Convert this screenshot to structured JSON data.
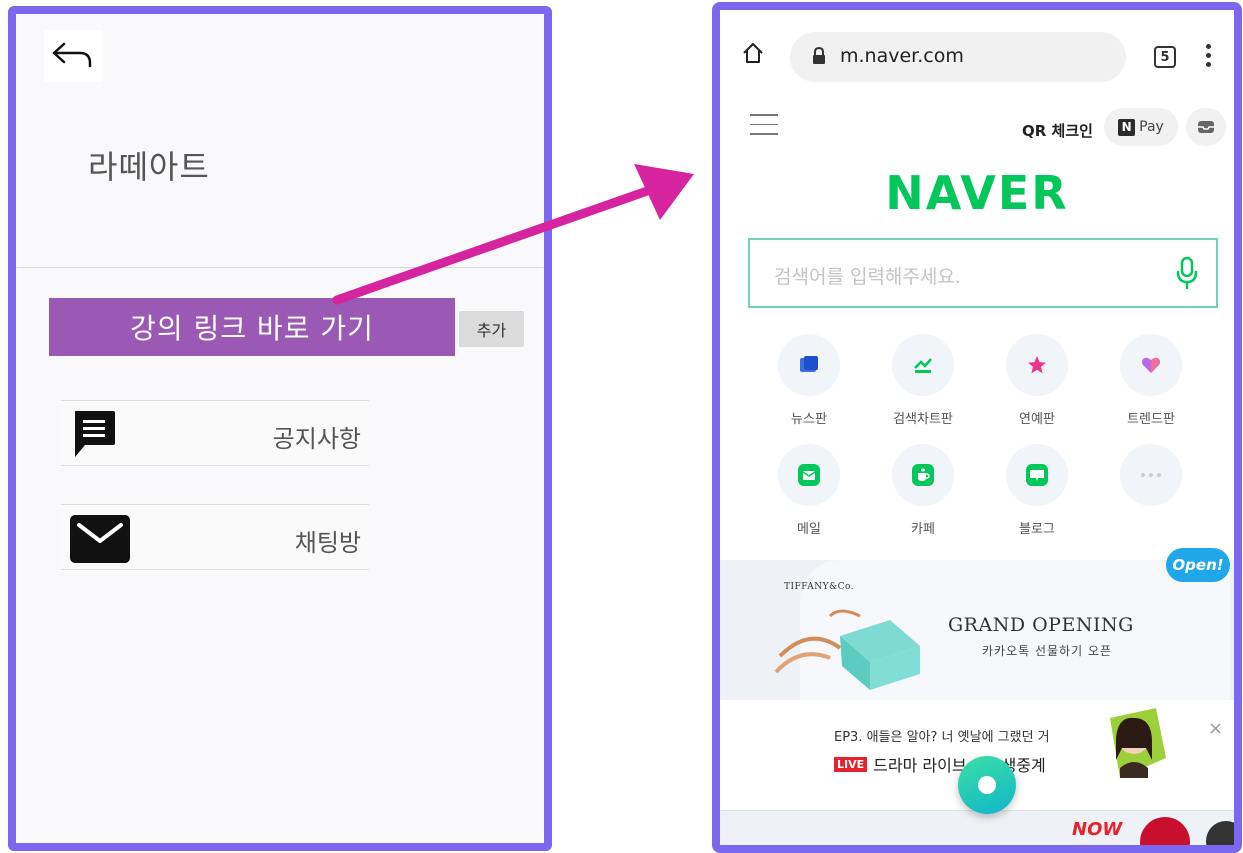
{
  "left_app": {
    "title": "라떼아트",
    "lecture_button": "강의 링크 바로 가기",
    "add_button": "추가",
    "menu": [
      {
        "label": "공지사항",
        "icon": "message-icon"
      },
      {
        "label": "채팅방",
        "icon": "mail-icon"
      }
    ]
  },
  "browser": {
    "url": "m.naver.com",
    "tab_count": "5"
  },
  "naver": {
    "qr_checkin": "QR 체크인",
    "pay_label": "Pay",
    "pay_letter": "N",
    "logo": "NAVER",
    "search_placeholder": "검색어를 입력해주세요.",
    "services": [
      {
        "label": "뉴스판",
        "icon": "news-icon"
      },
      {
        "label": "검색차트판",
        "icon": "chart-icon"
      },
      {
        "label": "연예판",
        "icon": "star-icon"
      },
      {
        "label": "트렌드판",
        "icon": "heart-icon"
      },
      {
        "label": "메일",
        "icon": "mail-icon"
      },
      {
        "label": "카페",
        "icon": "cafe-icon"
      },
      {
        "label": "블로그",
        "icon": "blog-icon"
      },
      {
        "label": "",
        "icon": "more-icon"
      }
    ],
    "banner": {
      "brand": "TIFFANY&Co.",
      "headline": "GRAND OPENING",
      "subline": "카카오톡 선물하기 오픈",
      "badge": "Open!"
    },
    "live": {
      "line1": "EP3. 애들은 알아? 너 옛날에 그랬던 거",
      "badge": "LIVE",
      "line2": "드라마 라이브 3화 생중계",
      "close": "×"
    },
    "bottom_now": "NOW"
  },
  "colors": {
    "frame": "#7b68ee",
    "arrow": "#d6249f",
    "naver_green": "#03c75a",
    "lecture_purple": "#9b59b6"
  }
}
